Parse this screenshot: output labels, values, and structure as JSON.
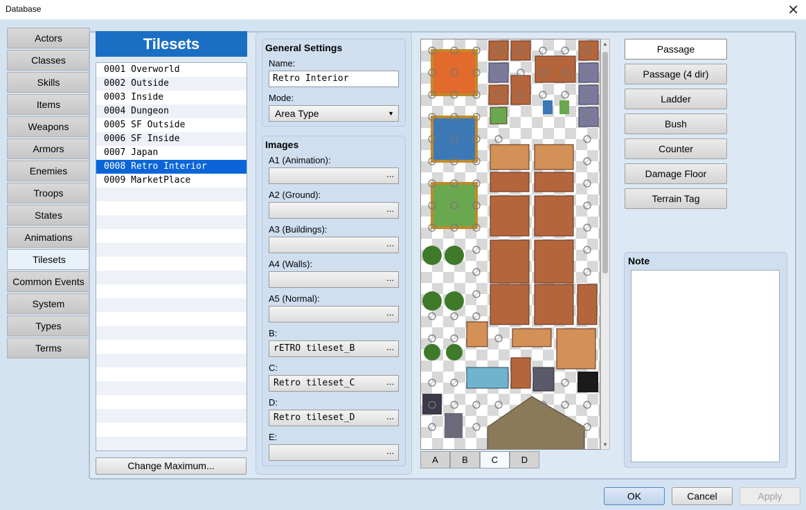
{
  "window": {
    "title": "Database",
    "close_glyph": "✕"
  },
  "categories": [
    "Actors",
    "Classes",
    "Skills",
    "Items",
    "Weapons",
    "Armors",
    "Enemies",
    "Troops",
    "States",
    "Animations",
    "Tilesets",
    "Common Events",
    "System",
    "Types",
    "Terms"
  ],
  "active_category": "Tilesets",
  "tileset_list": {
    "header": "Tilesets",
    "items": [
      "0001 Overworld",
      "0002 Outside",
      "0003 Inside",
      "0004 Dungeon",
      "0005 SF Outside",
      "0006 SF Inside",
      "0007 Japan",
      "0008 Retro Interior",
      "0009 MarketPlace"
    ],
    "selected": "0008 Retro Interior",
    "change_max_label": "Change Maximum..."
  },
  "general": {
    "header": "General Settings",
    "name_label": "Name:",
    "name_value": "Retro Interior",
    "mode_label": "Mode:",
    "mode_value": "Area Type"
  },
  "images": {
    "header": "Images",
    "fields": [
      {
        "label": "A1 (Animation):",
        "value": ""
      },
      {
        "label": "A2 (Ground):",
        "value": ""
      },
      {
        "label": "A3 (Buildings):",
        "value": ""
      },
      {
        "label": "A4 (Walls):",
        "value": ""
      },
      {
        "label": "A5 (Normal):",
        "value": ""
      },
      {
        "label": "B:",
        "value": "rETRO tileset_B"
      },
      {
        "label": "C:",
        "value": "Retro tileset_C"
      },
      {
        "label": "D:",
        "value": "Retro tileset_D"
      },
      {
        "label": "E:",
        "value": ""
      }
    ],
    "browse_glyph": "..."
  },
  "tile_pages": [
    "A",
    "B",
    "C",
    "D"
  ],
  "active_page": "C",
  "passage_buttons": [
    "Passage",
    "Passage (4 dir)",
    "Ladder",
    "Bush",
    "Counter",
    "Damage Floor",
    "Terrain Tag"
  ],
  "active_passage": "Passage",
  "note": {
    "label": "Note",
    "value": ""
  },
  "footer": {
    "ok": "OK",
    "cancel": "Cancel",
    "apply": "Apply"
  }
}
